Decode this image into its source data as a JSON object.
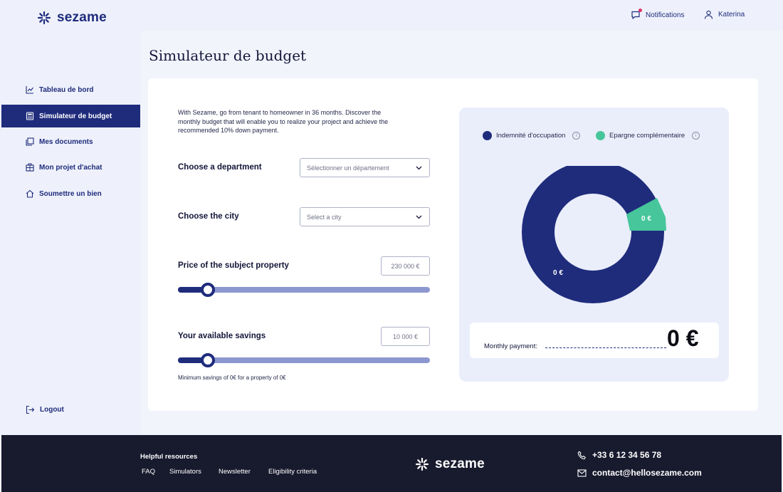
{
  "header": {
    "brand": "sezame",
    "notifications_label": "Notifications",
    "user_name": "Katerina"
  },
  "sidebar": {
    "items": [
      {
        "label": "Tableau de bord",
        "icon": "chart-line-icon"
      },
      {
        "label": "Simulateur de budget",
        "icon": "calculator-icon",
        "active": true
      },
      {
        "label": "Mes documents",
        "icon": "documents-icon"
      },
      {
        "label": "Mon projet d'achat",
        "icon": "building-icon"
      },
      {
        "label": "Soumettre un bien",
        "icon": "home-icon"
      }
    ],
    "logout_label": "Logout"
  },
  "main": {
    "title": "Simulateur de budget",
    "intro": "With Sezame, go from tenant to homeowner in 36 months. Discover the monthly budget that will enable you to realize your project and achieve the recommended 10% down payment.",
    "department": {
      "label": "Choose a department",
      "placeholder": "Sélectionner un département"
    },
    "city": {
      "label": "Choose the city",
      "placeholder": "Select a city"
    },
    "price": {
      "label": "Price of the subject property",
      "value": "230 000 €",
      "slider_fraction": 0.12
    },
    "savings": {
      "label": "Your available savings",
      "value": "10 000 €",
      "slider_fraction": 0.12
    },
    "min_savings_note": "Minimum savings of 0€ for a property of 0€"
  },
  "panel": {
    "legend": [
      {
        "label": "Indemnité d'occupation",
        "color": "#1f2c7c"
      },
      {
        "label": "Epargne complémentaire",
        "color": "#46c69a"
      }
    ],
    "donut": {
      "occupation_value": "0 €",
      "savings_value": "0 €",
      "colors": {
        "occupation": "#1f2c7c",
        "savings": "#46c69a"
      }
    },
    "monthly_payment_label": "Monthly payment:",
    "monthly_payment_value": "0 €"
  },
  "footer": {
    "heading": "Helpful resources",
    "links": [
      "FAQ",
      "Simulators",
      "Newsletter",
      "Eligibility criteria"
    ],
    "brand": "sezame",
    "phone": "+33 6 12 34 56 78",
    "email": "contact@hellosezame.com"
  },
  "colors": {
    "primary": "#1f2c7c",
    "accent": "#46c69a",
    "footer_bg": "#181a2e",
    "page_bg": "#f2f4fc"
  }
}
